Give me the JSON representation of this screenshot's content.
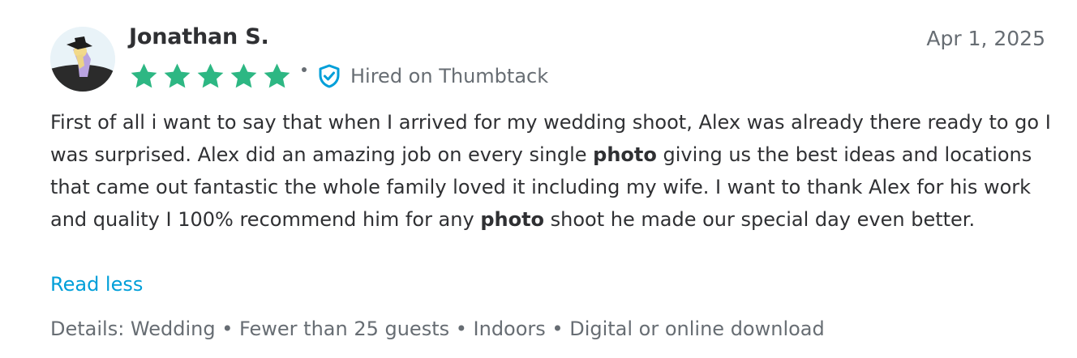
{
  "review": {
    "author": "Jonathan S.",
    "date": "Apr 1, 2025",
    "rating": 5,
    "rating_max": 5,
    "badge_label": "Hired on Thumbtack",
    "text_parts": [
      "First of all i want to say that when I arrived for my wedding shoot, Alex was already there ready to go I was surprised. Alex did an amazing job on every single ",
      "photo",
      " giving us the best ideas and locations that came out fantastic the whole family loved it including my wife. I want to thank Alex for his work and quality I 100% recommend him for any ",
      "photo",
      " shoot he made our special day even better."
    ],
    "toggle_label": "Read less",
    "details": "Details: Wedding • Fewer than 25 guests • Indoors • Digital or online download"
  },
  "colors": {
    "star": "#2db783",
    "link": "#009fd9",
    "shield": "#009fd9",
    "muted_text": "#676d73"
  },
  "icons": {
    "avatar": "user-avatar",
    "star": "star-icon",
    "badge": "shield-check-icon"
  }
}
